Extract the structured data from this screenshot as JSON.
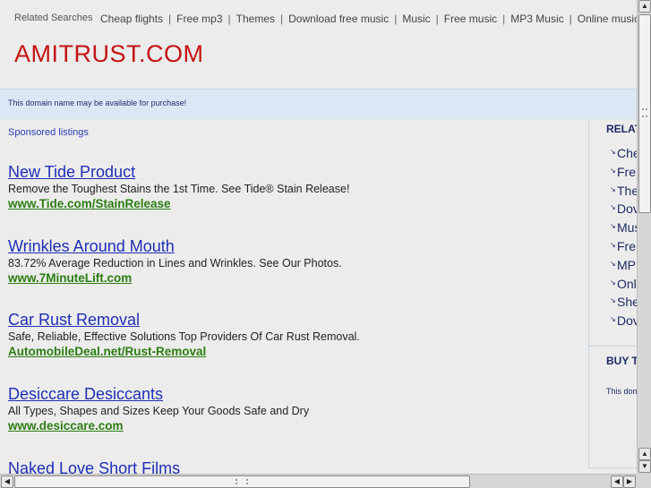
{
  "top_bar": {
    "label": "Related Searches",
    "links": [
      "Cheap flights",
      "Free mp3",
      "Themes",
      "Download free music",
      "Music",
      "Free music",
      "MP3 Music",
      "Online music"
    ],
    "separator": "|"
  },
  "domain": {
    "title": "AMITRUST.COM"
  },
  "availability": {
    "text": "This domain name may be available for purchase!"
  },
  "sponsored": {
    "label": "Sponsored listings"
  },
  "listings": [
    {
      "title": "New Tide Product",
      "description": "Remove the Toughest Stains the 1st Time. See Tide® Stain Release!",
      "url": "www.Tide.com/StainRelease"
    },
    {
      "title": "Wrinkles Around Mouth",
      "description": "83.72% Average Reduction in Lines and Wrinkles. See Our Photos.",
      "url": "www.7MinuteLift.com"
    },
    {
      "title": "Car Rust Removal",
      "description": "Safe, Reliable, Effective Solutions Top Providers Of Car Rust Removal.",
      "url": "AutomobileDeal.net/Rust-Removal"
    },
    {
      "title": "Desiccare Desiccants",
      "description": "All Types, Shapes and Sizes Keep Your Goods Safe and Dry",
      "url": "www.desiccare.com"
    },
    {
      "title": "Naked Love Short Films",
      "description": "",
      "url": ""
    }
  ],
  "sidebar": {
    "related_heading": "RELAT",
    "items": [
      "Che",
      "Fre",
      "The",
      "Dov",
      "Mus",
      "Fre",
      "MP",
      "Onl",
      "She",
      "Dov"
    ],
    "buy_heading": "BUY T",
    "buy_text": "This dom"
  },
  "icons": {
    "scroll_up": "▲",
    "scroll_down": "▼",
    "scroll_left": "◀",
    "scroll_right": "▶",
    "list_arrow": "↘"
  },
  "colors": {
    "domain_title": "#c41414",
    "link_blue": "#1f2fb5",
    "url_green": "#2c7d12",
    "availability_bg": "#dce7f5"
  }
}
